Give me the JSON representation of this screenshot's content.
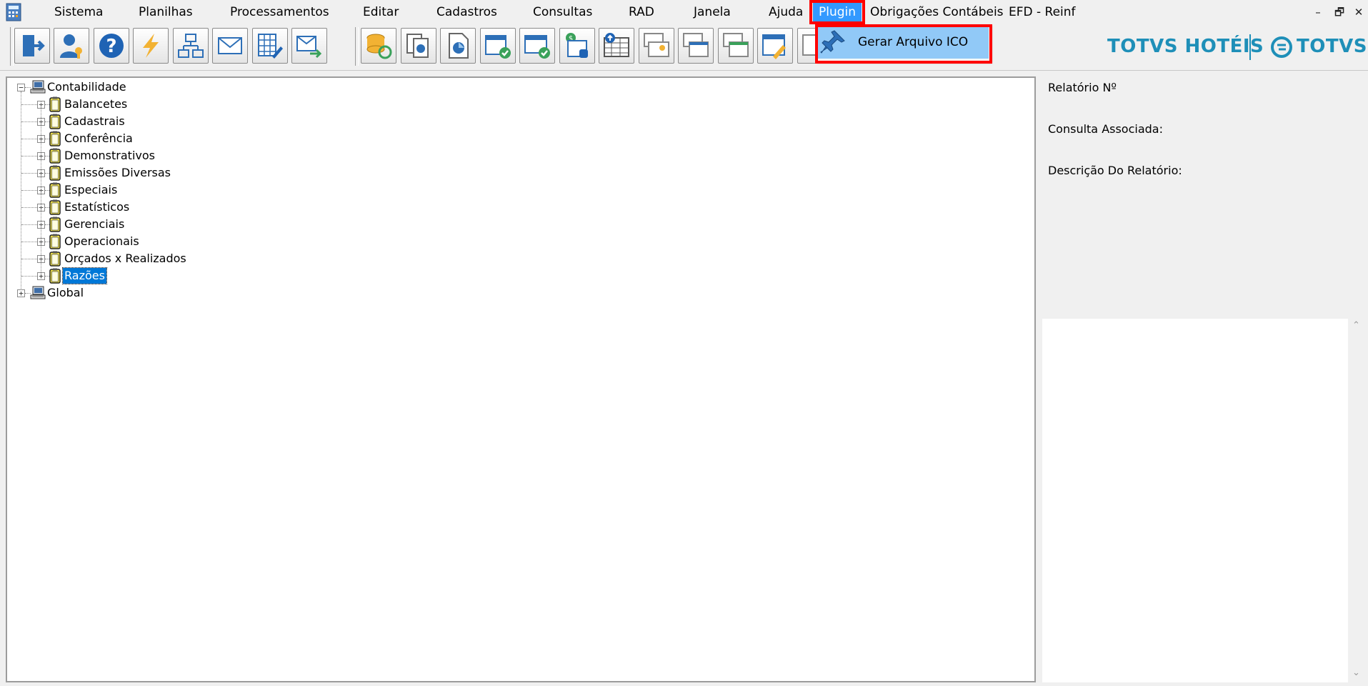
{
  "menu": {
    "items": [
      "Sistema",
      "Planilhas",
      "Processamentos",
      "Editar",
      "Cadastros",
      "Consultas",
      "RAD",
      "Janela",
      "Ajuda",
      "Plugin",
      "Obrigações Contábeis",
      "EFD - Reinf"
    ],
    "active": "Plugin"
  },
  "window_controls": {
    "minimize": "–",
    "restore": "🗗",
    "close": "✕"
  },
  "toolbar": {
    "buttons": [
      "exit",
      "user-key",
      "help",
      "lightning",
      "network",
      "mail",
      "spreadsheet-edit",
      "mail-send",
      "coins-refresh",
      "copy-documents",
      "chart-document",
      "calendar-check",
      "calendar-check-2",
      "money-calendar",
      "table-upload",
      "window-settings",
      "window-cascade",
      "window-tile",
      "window-edit",
      "window-more"
    ]
  },
  "dropdown": {
    "item_label": "Gerar Arquivo ICO",
    "icon": "pin-icon"
  },
  "logos": {
    "left": "TOTVS HOTÉIS",
    "right": "TOTVS"
  },
  "tree": {
    "root": "Contabilidade",
    "children": [
      "Balancetes",
      "Cadastrais",
      "Conferência",
      "Demonstrativos",
      "Emissões Diversas",
      "Especiais",
      "Estatísticos",
      "Gerenciais",
      "Operacionais",
      "Orçados x Realizados",
      "Razões"
    ],
    "selected": "Razões",
    "root2": "Global"
  },
  "info": {
    "report_no": "Relatório Nº",
    "associated_query": "Consulta Associada:",
    "description": "Descrição Do Relatório:"
  },
  "colors": {
    "accent": "#3399ff",
    "highlight": "#ff0000",
    "selection": "#0078d7",
    "logo": "#1e8fb8",
    "dropdown_hover": "#91c9f7"
  }
}
